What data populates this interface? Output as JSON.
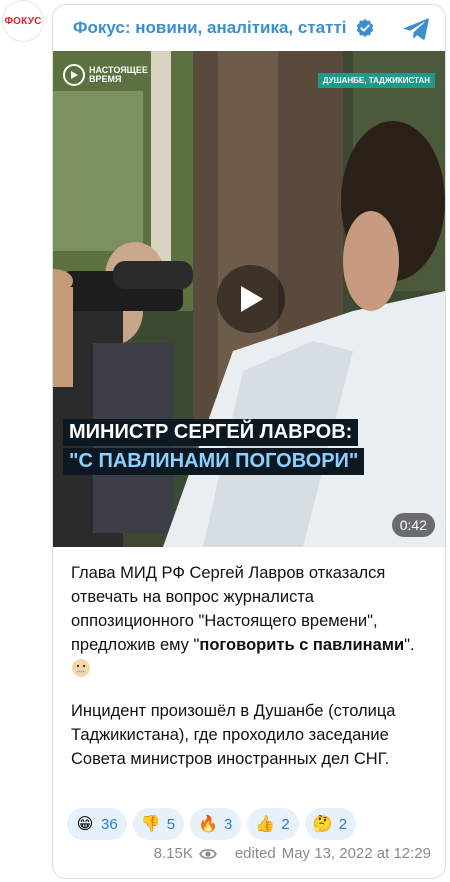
{
  "avatar": {
    "label": "ФОКУС"
  },
  "channel": {
    "name": "Фокус: новини, аналітика, статті"
  },
  "video": {
    "logo_text_line1": "настоящее",
    "logo_text_line2": "время",
    "location": "ДУШАНБЕ, ТАДЖИКИСТАН",
    "caption_line1": "МИНИСТР СЕРГЕЙ ЛАВРОВ:",
    "caption_line2": "\"С ПАВЛИНАМИ ПОГОВОРИ\"",
    "duration": "0:42"
  },
  "post": {
    "p1_before": "Глава МИД РФ Сергей Лавров отказался отвечать на вопрос журналиста оппозиционного \"Настоящего времени\", предложив ему \"",
    "p1_bold": "поговорить с павлинами",
    "p1_after": "\". ",
    "p2": "Инцидент произошёл в Душанбе (столица Таджикистана), где проходило заседание Совета министров иностранных дел СНГ."
  },
  "reactions": [
    {
      "emoji": "😁",
      "count": "36"
    },
    {
      "emoji": "👎",
      "count": "5"
    },
    {
      "emoji": "🔥",
      "count": "3"
    },
    {
      "emoji": "👍",
      "count": "2"
    },
    {
      "emoji": "🤔",
      "count": "2"
    }
  ],
  "meta": {
    "views": "8.15K",
    "edited": "edited",
    "date": "May 13, 2022 at 12:29"
  },
  "colors": {
    "accent": "#3a8fd0",
    "reaction_bg": "#e7f1fb",
    "brand_red": "#e8212a"
  },
  "icons": {
    "verified": "verified-badge-icon",
    "telegram": "telegram-icon",
    "play": "play-icon",
    "views": "eye-icon"
  }
}
